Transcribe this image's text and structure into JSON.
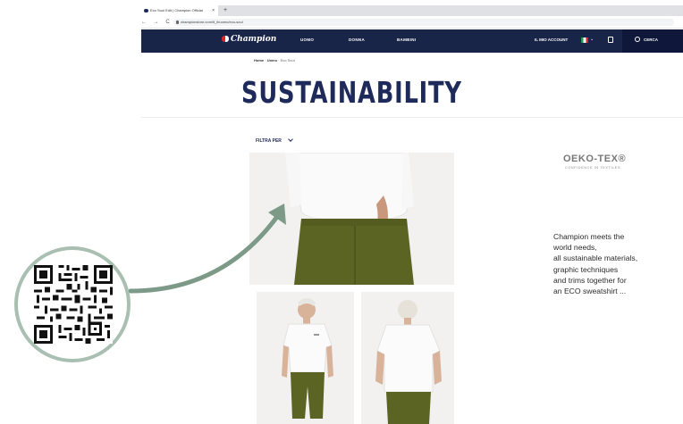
{
  "browser": {
    "tab_title": "Eco Soul Edit | Champion Official",
    "tab_close": "×",
    "new_tab": "+",
    "nav": "← → C",
    "url": "championstore.com/it_it/uomo/eco-soul"
  },
  "header": {
    "logo": "Champion",
    "nav": [
      "UOMO",
      "DONNA",
      "BAMBINI"
    ],
    "account": "IL MIO ACCOUNT",
    "chevron": "⌄",
    "search": "CERCA",
    "colors": {
      "navy": "#192449",
      "search_bg": "#0f183a"
    }
  },
  "breadcrumb": {
    "home": "Home",
    "sep1": " · ",
    "section": "Uomo",
    "sep2": " · ",
    "current": "Eco Soul"
  },
  "page": {
    "title": "SUSTAINABILITY",
    "filter_label": "FILTRA PER"
  },
  "certification": {
    "name": "OEKO-TEX",
    "mark": "®",
    "tagline": "CONFIDENCE IN TEXTILES"
  },
  "promo_lines": [
    "Champion meets the",
    "world needs,",
    "all sustainable materials,",
    "graphic techniques",
    "and trims together for",
    "an ECO sweatshirt ..."
  ],
  "overlay": {
    "ring_color": "#a9bfb2",
    "arrow_color": "#7d9a88"
  }
}
